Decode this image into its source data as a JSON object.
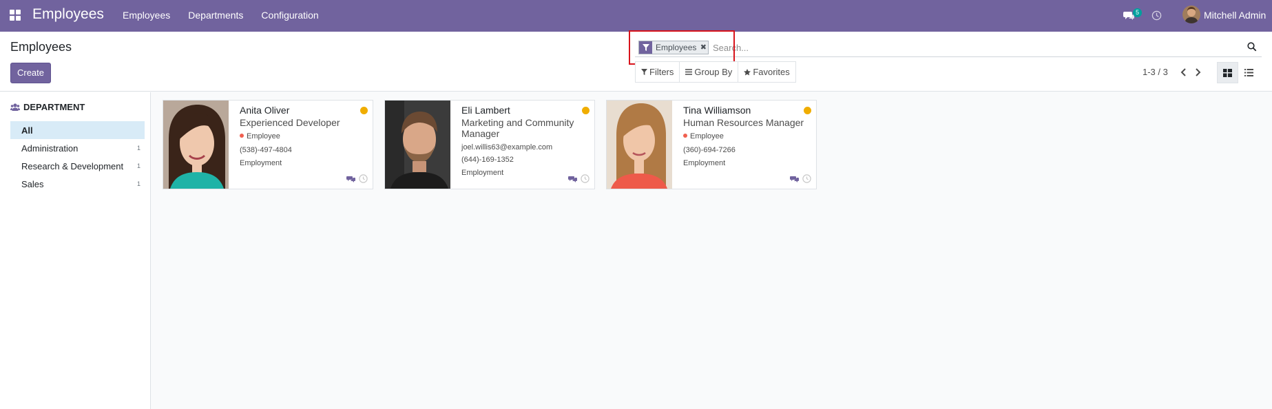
{
  "navbar": {
    "brand": "Employees",
    "menu": [
      "Employees",
      "Departments",
      "Configuration"
    ],
    "chat_badge": "5",
    "user_name": "Mitchell Admin",
    "icons": [
      "apps-grid-icon",
      "chat-icon",
      "clock-icon",
      "avatar"
    ]
  },
  "control": {
    "title": "Employees",
    "create_label": "Create",
    "search": {
      "facet_value": "Employees",
      "placeholder": "Search..."
    },
    "filters_label": "Filters",
    "groupby_label": "Group By",
    "favorites_label": "Favorites",
    "pager": "1-3 / 3"
  },
  "sidebar": {
    "header": "DEPARTMENT",
    "items": [
      {
        "label": "All",
        "count": "",
        "active": true
      },
      {
        "label": "Administration",
        "count": "1"
      },
      {
        "label": "Research & Development",
        "count": "1"
      },
      {
        "label": "Sales",
        "count": "1"
      }
    ]
  },
  "cards": [
    {
      "name": "Anita Oliver",
      "job": "Experienced Developer",
      "tag": "Employee",
      "phone": "(538)-497-4804",
      "note": "Employment"
    },
    {
      "name": "Eli Lambert",
      "job": "Marketing and Community Manager",
      "email": "joel.willis63@example.com",
      "phone": "(644)-169-1352",
      "note": "Employment"
    },
    {
      "name": "Tina Williamson",
      "job": "Human Resources Manager",
      "tag": "Employee",
      "phone": "(360)-694-7266",
      "note": "Employment"
    }
  ],
  "colors": {
    "brand": "#71639e",
    "status_away": "#f0ad00",
    "tag": "#f06050",
    "highlight": "#d8141c"
  }
}
